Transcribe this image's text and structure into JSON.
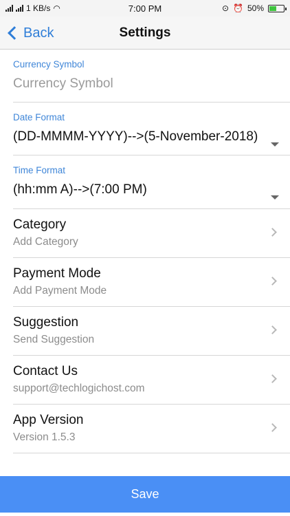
{
  "status_bar": {
    "net_left": ".ıll .ıll",
    "speed": "1 KB/s",
    "time": "7:00 PM",
    "battery": "50%",
    "battery_level": 0.5
  },
  "nav": {
    "back_label": "Back",
    "title": "Settings"
  },
  "currency": {
    "label": "Currency Symbol",
    "placeholder": "Currency Symbol"
  },
  "date_format": {
    "label": "Date Format",
    "value": "(DD-MMMM-YYYY)-->(5-November-2018)"
  },
  "time_format": {
    "label": "Time Format",
    "value": "(hh:mm A)-->(7:00 PM)"
  },
  "rows": [
    {
      "title": "Category",
      "subtitle": "Add Category"
    },
    {
      "title": "Payment Mode",
      "subtitle": "Add Payment Mode"
    },
    {
      "title": "Suggestion",
      "subtitle": "Send Suggestion"
    },
    {
      "title": "Contact Us",
      "subtitle": "support@techlogichost.com"
    },
    {
      "title": "App Version",
      "subtitle": "Version 1.5.3"
    }
  ],
  "save_label": "Save",
  "colors": {
    "accent": "#2f7ed8",
    "save_button": "#4a8ff5"
  }
}
